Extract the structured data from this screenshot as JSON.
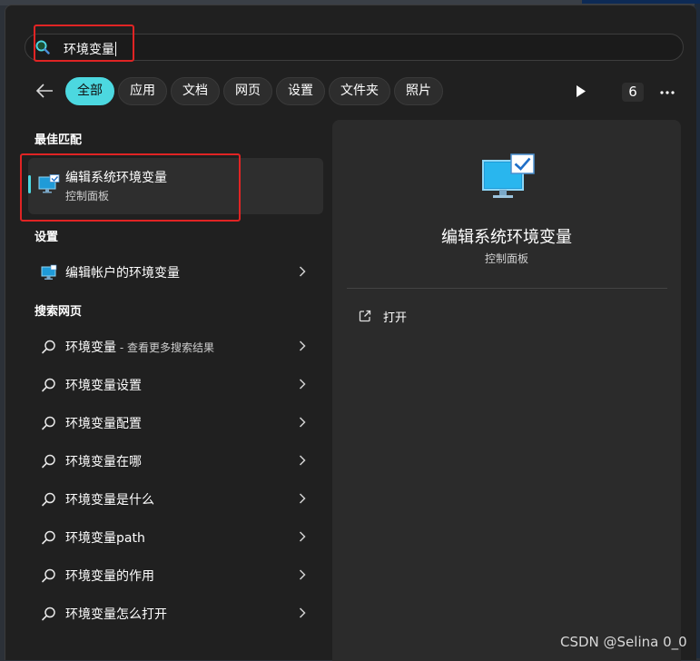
{
  "search": {
    "query": "环境变量"
  },
  "filters": {
    "items": [
      "全部",
      "应用",
      "文档",
      "网页",
      "设置",
      "文件夹",
      "照片"
    ],
    "count": "6"
  },
  "best_match": {
    "section_label": "最佳匹配",
    "title": "编辑系统环境变量",
    "subtitle": "控制面板"
  },
  "settings": {
    "section_label": "设置",
    "items": [
      {
        "label": "编辑帐户的环境变量"
      }
    ]
  },
  "web": {
    "section_label": "搜索网页",
    "first": {
      "label": "环境变量",
      "hint": " - 查看更多搜索结果"
    },
    "items": [
      {
        "label": "环境变量设置"
      },
      {
        "label": "环境变量配置"
      },
      {
        "label": "环境变量在哪"
      },
      {
        "label": "环境变量是什么"
      },
      {
        "label": "环境变量path"
      },
      {
        "label": "环境变量的作用"
      },
      {
        "label": "环境变量怎么打开"
      }
    ]
  },
  "preview": {
    "title": "编辑系统环境变量",
    "subtitle": "控制面板",
    "actions": [
      {
        "label": "打开"
      }
    ]
  },
  "watermark": "CSDN @Selina 0_0",
  "colors": {
    "accent": "#4cd8e0",
    "highlight_box": "#e02424",
    "panel": "#202020"
  },
  "icons": {
    "search": "search-icon",
    "back": "back-arrow-icon",
    "play": "play-icon",
    "more": "more-icon",
    "app": "monitor-check-icon",
    "settings_item": "monitor-settings-icon",
    "web": "web-search-icon",
    "chevron": "chevron-right-icon",
    "open": "open-external-icon"
  }
}
